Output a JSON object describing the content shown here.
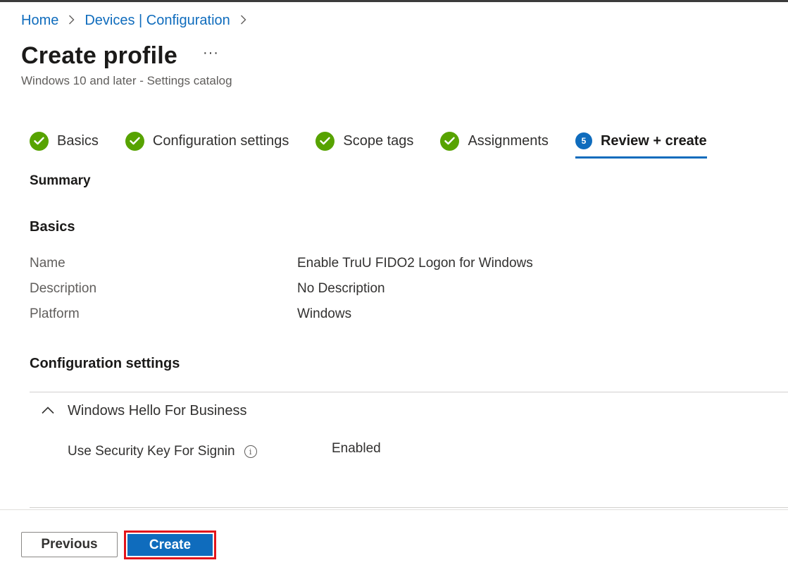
{
  "breadcrumb": {
    "items": [
      "Home",
      "Devices | Configuration"
    ]
  },
  "header": {
    "title": "Create profile",
    "more_label": "···",
    "subtitle": "Windows 10 and later - Settings catalog"
  },
  "steps": [
    {
      "label": "Basics",
      "status": "complete"
    },
    {
      "label": "Configuration settings",
      "status": "complete"
    },
    {
      "label": "Scope tags",
      "status": "complete"
    },
    {
      "label": "Assignments",
      "status": "complete"
    },
    {
      "label": "Review + create",
      "status": "current",
      "number": "5"
    }
  ],
  "summary": {
    "heading": "Summary",
    "basics": {
      "heading": "Basics",
      "rows": [
        {
          "key": "Name",
          "value": "Enable TruU FIDO2 Logon for Windows"
        },
        {
          "key": "Description",
          "value": "No Description"
        },
        {
          "key": "Platform",
          "value": "Windows"
        }
      ]
    },
    "config": {
      "heading": "Configuration settings",
      "group": "Windows Hello For Business",
      "setting": {
        "name": "Use Security Key For Signin",
        "info_glyph": "i",
        "value": "Enabled"
      }
    }
  },
  "footer": {
    "previous_label": "Previous",
    "create_label": "Create"
  },
  "colors": {
    "accent": "#0f6cbd",
    "success": "#57a300",
    "highlight": "#e3141b"
  },
  "icons": [
    "chevron-right-icon",
    "ellipsis-icon",
    "checkmark-icon",
    "chevron-up-icon",
    "info-icon"
  ]
}
